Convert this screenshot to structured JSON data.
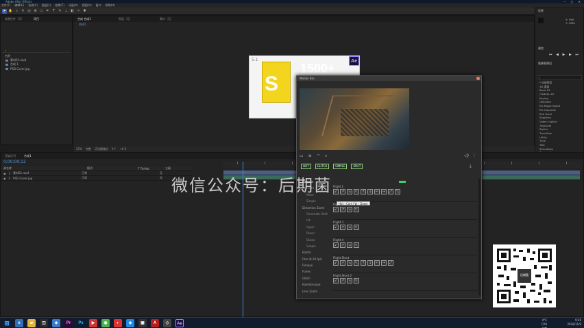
{
  "menubar": [
    "文件(F)",
    "编辑(E)",
    "合成(C)",
    "图层(L)",
    "效果(T)",
    "动画(A)",
    "视图(V)",
    "窗口",
    "帮助(H)"
  ],
  "panels": {
    "project_tabs": [
      "效果控件（无）",
      "项目"
    ],
    "viewer_tabs": [
      "合成 合成1",
      "图层（无）",
      "素材（无）"
    ],
    "viewer_breadcrumb": "合成1",
    "viewer_zoom": "25%",
    "viewer_quality": "完整",
    "viewer_camera": "活动摄像机",
    "viewer_views": "1个",
    "viewer_offset": "+0.0"
  },
  "project": {
    "header_name": "名称",
    "items": [
      "素材01.mp4",
      "合成 1",
      "PSD Cover.jpg"
    ]
  },
  "timeline": {
    "tabs": [
      "渲染队列",
      "合成1"
    ],
    "timecode": "0;00;00;12",
    "col_headers": [
      "源名称",
      "模式",
      "T TrkMat",
      "父级"
    ],
    "layers": [
      {
        "index": "1",
        "name": "素材01.mp4",
        "mode": "正常",
        "parent": "无"
      },
      {
        "index": "2",
        "name": "PSD Cover.jpg",
        "mode": "正常",
        "parent": "无"
      }
    ]
  },
  "right_panel": {
    "info_title": "信息",
    "coords": [
      "X: 960",
      "Y: 1080"
    ],
    "preview_title": "预览",
    "effects_title": "效果和预设",
    "search_placeholder": "",
    "effects": [
      "* 动画预设",
      "3D 通道",
      "Boris FX",
      "CINEMA 4D",
      "Keying",
      "Obsolete",
      "RG Magic Bullet",
      "RG Trapcode",
      "Red Giant",
      "Sapphire",
      "Video Copilot",
      "Trapcode",
      "Stylize",
      "Transition",
      "Utility",
      "Time",
      "Text",
      "Simulation",
      "Perspective",
      "Noise & Grain",
      "Matte",
      "Generate"
    ]
  },
  "promo": {
    "version": "5.1",
    "big_text": "1500+",
    "ae_badge": "Ae"
  },
  "motion_bro": {
    "title": "Motion Bro",
    "categories": [
      "HOT",
      "GLITCH",
      "SIMPLE",
      "SPLIT"
    ],
    "sidebar": [
      {
        "label": "Camera",
        "level": "top",
        "selected": true
      },
      {
        "label": "Flight",
        "level": "sub"
      },
      {
        "label": "Move",
        "level": "sub"
      },
      {
        "label": "Simple",
        "level": "sub"
      },
      {
        "label": "Distortion Zoom",
        "level": "top"
      },
      {
        "label": "Chromatic Shift",
        "level": "sub"
      },
      {
        "label": "Hit",
        "level": "sub"
      },
      {
        "label": "Hyper",
        "level": "sub"
      },
      {
        "label": "Power",
        "level": "sub"
      },
      {
        "label": "Shake",
        "level": "sub"
      },
      {
        "label": "Simple",
        "level": "sub"
      },
      {
        "label": "Elastic",
        "level": "top"
      },
      {
        "label": "Film (8-16 fps)",
        "level": "top"
      },
      {
        "label": "Fisheye",
        "level": "top"
      },
      {
        "label": "Flares",
        "level": "top"
      },
      {
        "label": "Glitch",
        "level": "top"
      },
      {
        "label": "Kaleidoscope",
        "level": "top"
      },
      {
        "label": "Lens Zoom",
        "level": "top"
      }
    ],
    "groups": [
      {
        "title": "Flight 1",
        "thumbs": 10
      },
      {
        "title": "Flight 2",
        "thumbs": 4
      },
      {
        "title": "Flight 3",
        "thumbs": 4
      },
      {
        "title": "Flight 4",
        "thumbs": 4
      },
      {
        "title": "Flight Short",
        "thumbs": 9
      },
      {
        "title": "Flight Short 2",
        "thumbs": 4
      }
    ],
    "tooltip": "Hot - Cam Fpl - Down"
  },
  "watermark": "微信公众号：后期菌",
  "qr_center_text": "后期菌",
  "tray": {
    "temp": "4°C",
    "cpu": "CPU温度",
    "time": "9:20",
    "date": "2018/11/9"
  },
  "colors": {
    "accent": "#3d5ea8",
    "timecode": "#4d9ae0",
    "category_border": "#8fd26a",
    "close": "#d65b3a"
  }
}
